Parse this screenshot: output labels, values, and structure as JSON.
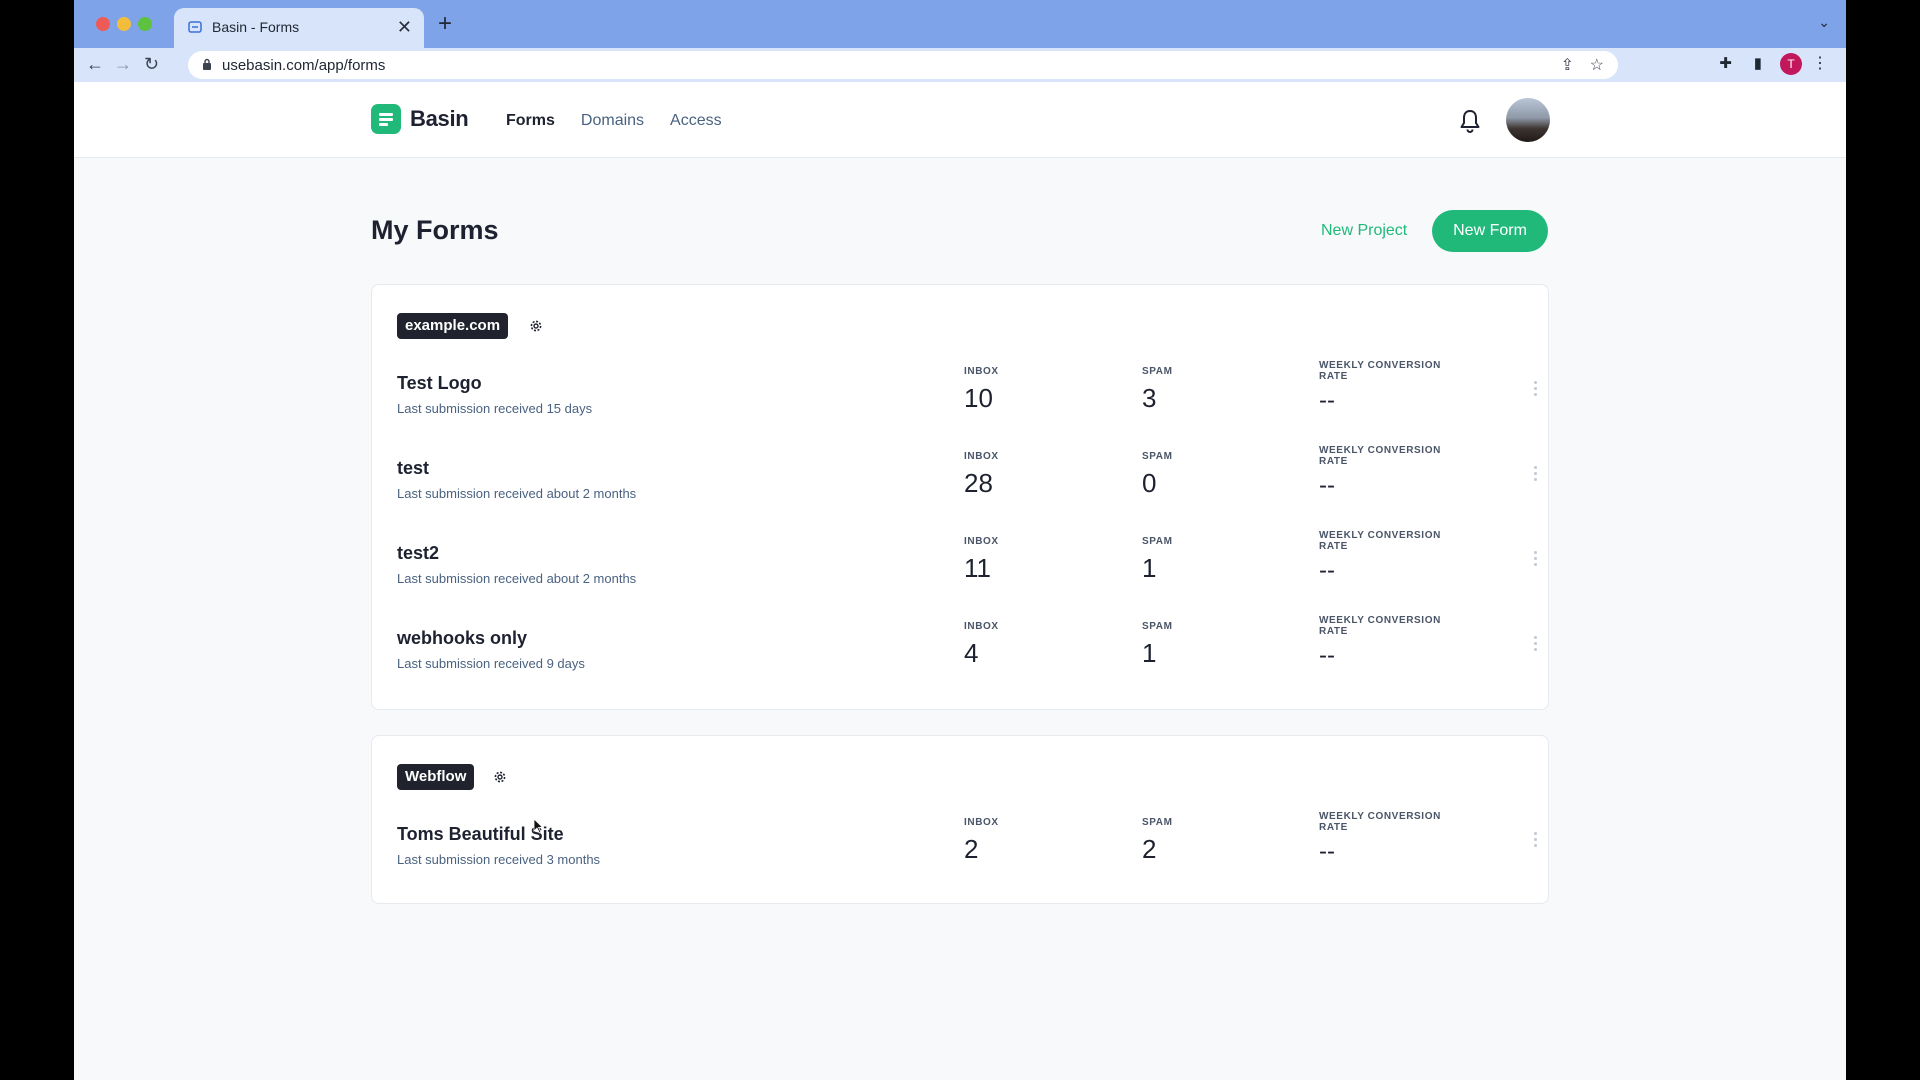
{
  "browser": {
    "tab_title": "Basin - Forms",
    "tab_close": "✕",
    "new_tab": "+",
    "url": "usebasin.com/app/forms",
    "profile_initial": "T"
  },
  "app": {
    "brand": "Basin",
    "nav": [
      {
        "label": "Forms",
        "active": true
      },
      {
        "label": "Domains",
        "active": false
      },
      {
        "label": "Access",
        "active": false
      }
    ]
  },
  "page": {
    "title": "My Forms",
    "new_project_label": "New Project",
    "new_form_label": "New Form"
  },
  "labels": {
    "inbox": "INBOX",
    "spam": "SPAM",
    "conversion": "WEEKLY CONVERSION RATE"
  },
  "projects": [
    {
      "name": "example.com",
      "forms": [
        {
          "name": "Test Logo",
          "last_submission": "Last submission received 15 days",
          "inbox": "10",
          "spam": "3",
          "conversion": "--"
        },
        {
          "name": "test",
          "last_submission": "Last submission received about 2 months",
          "inbox": "28",
          "spam": "0",
          "conversion": "--"
        },
        {
          "name": "test2",
          "last_submission": "Last submission received about 2 months",
          "inbox": "11",
          "spam": "1",
          "conversion": "--"
        },
        {
          "name": "webhooks only",
          "last_submission": "Last submission received 9 days",
          "inbox": "4",
          "spam": "1",
          "conversion": "--"
        }
      ]
    },
    {
      "name": "Webflow",
      "forms": [
        {
          "name": "Toms Beautiful Site",
          "last_submission": "Last submission received 3 months",
          "inbox": "2",
          "spam": "2",
          "conversion": "--"
        }
      ]
    }
  ],
  "colors": {
    "brand": "#20b97a",
    "badge": "#20232d",
    "browser_frame": "#7ea3e8"
  }
}
